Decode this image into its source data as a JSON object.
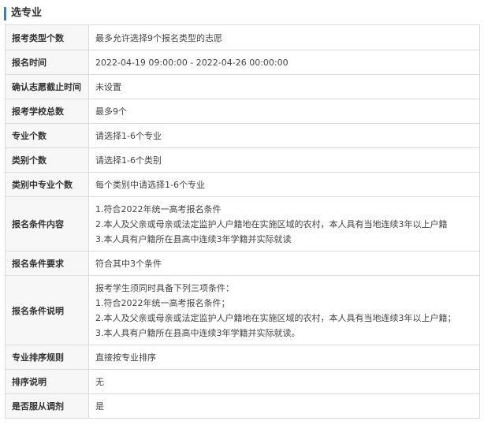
{
  "section": {
    "title": "选专业"
  },
  "rows": [
    {
      "label": "报考类型个数",
      "value": "最多允许选择9个报名类型的志愿"
    },
    {
      "label": "报名时间",
      "value": "2022-04-19 09:00:00 - 2022-04-26 00:00:00"
    },
    {
      "label": "确认志愿截止时间",
      "value": "未设置"
    },
    {
      "label": "报考学校总数",
      "value": "最多9个"
    },
    {
      "label": "专业个数",
      "value": "请选择1-6个专业"
    },
    {
      "label": "类别个数",
      "value": "请选择1-6个类别"
    },
    {
      "label": "类别中专业个数",
      "value": "每个类别中请选择1-6个专业"
    },
    {
      "label": "报名条件内容",
      "lines": [
        "1.符合2022年统一高考报名条件",
        "2.本人及父亲或母亲或法定监护人户籍地在实施区域的农村，本人具有当地连续3年以上户籍",
        "3.本人具有户籍所在县高中连续3年学籍并实际就读"
      ]
    },
    {
      "label": "报名条件要求",
      "value": "符合其中3个条件"
    },
    {
      "label": "报名条件说明",
      "lines": [
        "报考学生须同时具备下列三项条件：",
        "1.符合2022年统一高考报名条件；",
        "2.本人及父亲或母亲或法定监护人户籍地在实施区域的农村，本人具有当地连续3年以上户籍；",
        "3.本人具有户籍所在县高中连续3年学籍并实际就读。"
      ]
    },
    {
      "label": "专业排序规则",
      "value": "直接按专业排序"
    },
    {
      "label": "排序说明",
      "value": "无"
    },
    {
      "label": "是否服从调剂",
      "value": "是"
    }
  ]
}
